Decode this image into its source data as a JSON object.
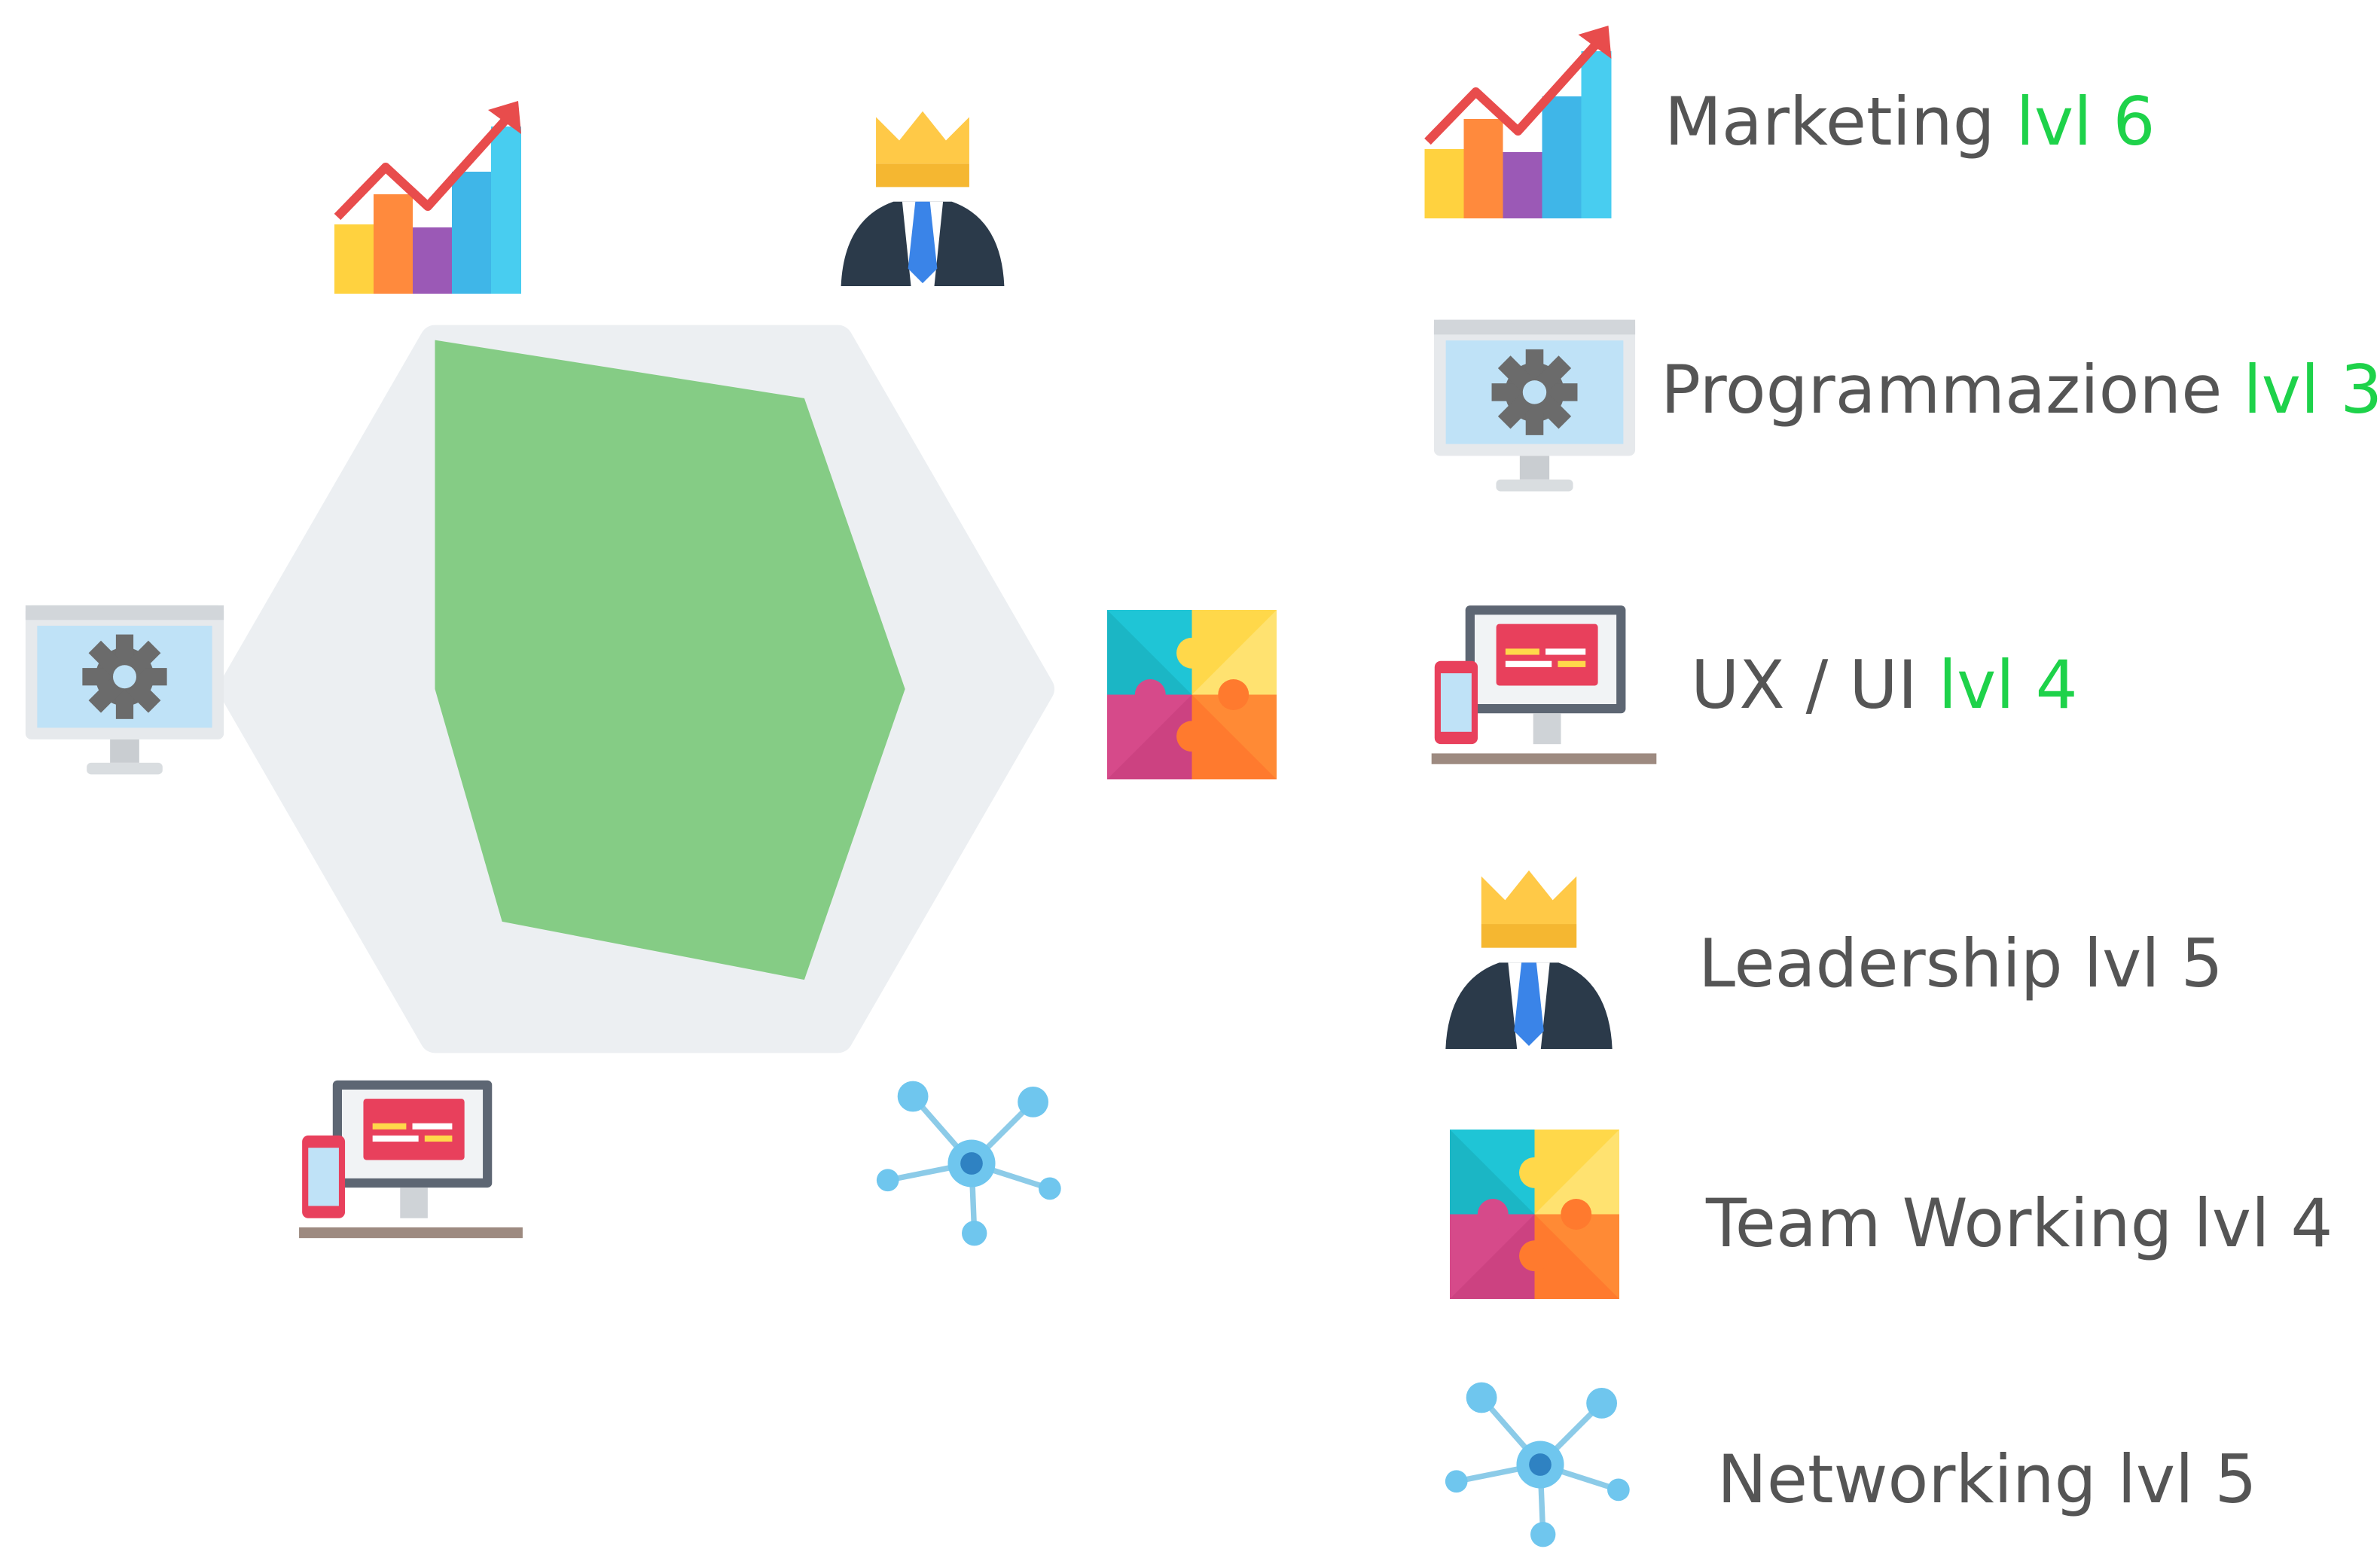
{
  "chart_data": {
    "type": "radar",
    "max_level": 6,
    "axes": [
      "Leadership",
      "Team Working",
      "Networking",
      "UX / UI",
      "Programmazione",
      "Marketing"
    ],
    "values": [
      5,
      4,
      5,
      4,
      3,
      6
    ],
    "fill_color": "#85cc85",
    "background_color": "#eceff2"
  },
  "legend": [
    {
      "name": "Marketing",
      "level_text": "lvl 6",
      "level_highlight": true,
      "icon": "growth-chart-icon"
    },
    {
      "name": "Programmazione",
      "level_text": "lvl 3",
      "level_highlight": true,
      "icon": "monitor-gear-icon"
    },
    {
      "name": "UX / UI",
      "level_text": "lvl 4",
      "level_highlight": true,
      "icon": "responsive-devices-icon"
    },
    {
      "name": "Leadership",
      "level_text": "lvl 5",
      "level_highlight": false,
      "icon": "crowned-leader-icon"
    },
    {
      "name": "Team Working",
      "level_text": "lvl 4",
      "level_highlight": false,
      "icon": "puzzle-icon"
    },
    {
      "name": "Networking",
      "level_text": "lvl 5",
      "level_highlight": false,
      "icon": "network-nodes-icon"
    }
  ],
  "colors": {
    "label": "#555555",
    "level_highlight": "#1ed24a"
  }
}
